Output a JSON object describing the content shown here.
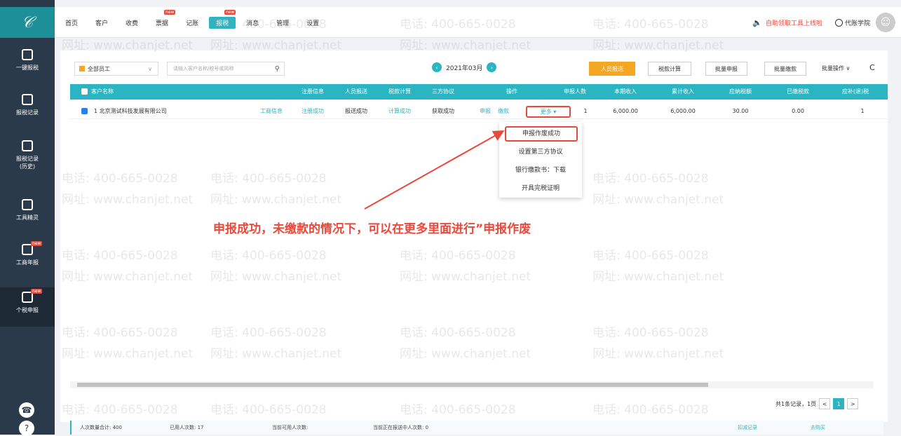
{
  "sidebar": {
    "items": [
      {
        "label": "一键报税"
      },
      {
        "label": "报税记录"
      },
      {
        "label": "报税记录(历史)"
      },
      {
        "label": "工具精灵"
      },
      {
        "label": "工商年报",
        "badge": "new"
      },
      {
        "label": "个税申报",
        "badge": "new"
      }
    ]
  },
  "topnav": {
    "items": [
      "首页",
      "客户",
      "收费",
      "票据",
      "记账",
      "报税",
      "消息",
      "管理",
      "设置"
    ],
    "new_badge": "new",
    "tool_link": "自助领取工具上线啦",
    "academy": "代账学院"
  },
  "toolbar": {
    "employee_select": "全部员工",
    "search_placeholder": "请输入客户名称/税号或简称",
    "period": "2021年03月",
    "btn_personnel": "人员报送",
    "btn_tax_calc": "税款计算",
    "btn_batch_declare": "批量申报",
    "btn_batch_pay": "批量缴款",
    "batch_op": "批量操作 ∨"
  },
  "table": {
    "headers": [
      "客户名称",
      "注册信息",
      "人员报送",
      "税款计算",
      "三方协议",
      "操作",
      "申报人数",
      "本期收入",
      "累计收入",
      "应纳税额",
      "已缴税款",
      "应补(退)税"
    ],
    "row": {
      "name": "1 北京测试科技发展有限公司",
      "reg_link": "工商信息",
      "reg_status": "注册成功",
      "personnel": "报送成功",
      "tax_calc": "计算成功",
      "tripartite": "获取成功",
      "op_declare": "申报",
      "op_pay": "缴款",
      "more": "更多 ▾",
      "count": "1",
      "income": "6,000.00",
      "cum_income": "6,000.00",
      "tax_due": "30.00",
      "tax_paid": "0.00",
      "tax_refund": "1"
    }
  },
  "dropdown": {
    "items": [
      "申报作废成功",
      "设置第三方协议",
      "银行缴款书：下载",
      "开具完税证明"
    ]
  },
  "annotation": "申报成功，未缴款的情况下，可以在更多里面进行”申报作废",
  "pager": {
    "total": "共1条记录，1页",
    "prev": "<",
    "page": "1",
    "next": ">"
  },
  "footer": {
    "total_people": "人次数量合计: 400",
    "used": "已用人次数: 17",
    "available": "当前可用人次数: ",
    "in_declare": "当前正在报送中人次数: 0",
    "record_link": "扣减记录",
    "buy_link": "去购买"
  },
  "watermark": {
    "phone": "电话: 400-665-0028",
    "site": "网址: www.chanjet.net"
  },
  "colors": {
    "accent": "#2bb5c2",
    "warning": "#e8493b",
    "orange": "#f5a623",
    "sidebar": "#2b3a4a"
  }
}
